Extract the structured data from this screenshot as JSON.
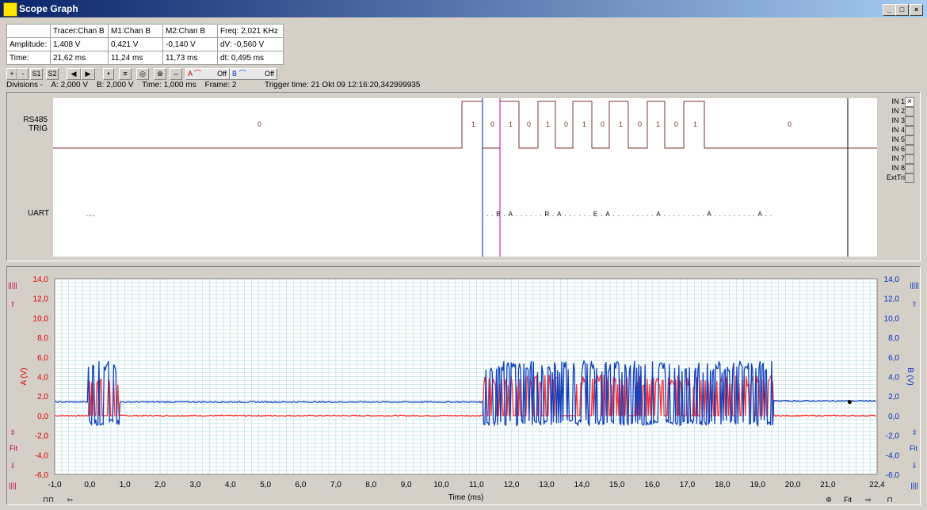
{
  "window": {
    "title": "Scope Graph",
    "controls": [
      "_",
      "□",
      "×"
    ]
  },
  "measurements": {
    "header": [
      "",
      "Tracer:Chan B",
      "M1:Chan B",
      "M2:Chan B",
      "Freq: 2,021 KHz"
    ],
    "rows": [
      [
        "Amplitude:",
        "1,408 V",
        "0,421 V",
        "-0,140 V",
        "dV: -0,560 V"
      ],
      [
        "Time:",
        "21,62 ms",
        "11,24 ms",
        "11,73 ms",
        "dt: 0,495 ms"
      ]
    ]
  },
  "toolbar": {
    "buttons": [
      "+",
      "-",
      "S1",
      "S2",
      "◀",
      "▶",
      "•",
      "≡",
      "◎",
      "⊕",
      "⇔"
    ],
    "channel_a_label": "A",
    "channel_a_state": "Off",
    "channel_b_label": "B",
    "channel_b_state": "Off"
  },
  "divisions": {
    "label": "Divisions -",
    "a": "A: 2,000 V",
    "b": "B: 2,000 V",
    "time": "Time: 1,000 ms",
    "frame": "Frame: 2",
    "trigger_time": "Trigger time: 21 Okt 09 12:16:20,342999935"
  },
  "logic": {
    "channels": [
      {
        "name_line1": "RS485",
        "name_line2": "TRIG"
      },
      {
        "name_line1": "UART",
        "name_line2": ""
      }
    ],
    "bits_left": "0",
    "bits_mid": [
      "1",
      "0",
      "1",
      "0",
      "1",
      "0",
      "1",
      "0",
      "1",
      "0",
      "1",
      "0",
      "1"
    ],
    "bits_right": "0",
    "uart_left": ".....",
    "uart_right": "...B.A......R.A......E.A.........A.........A.........A..",
    "inputs": [
      "IN 1",
      "IN 2",
      "IN 3",
      "IN 4",
      "IN 5",
      "IN 6",
      "IN 7",
      "IN 8",
      "ExtTri"
    ],
    "input_checked": [
      true,
      false,
      false,
      false,
      false,
      false,
      false,
      false,
      false
    ]
  },
  "chart_data": {
    "type": "line",
    "xlabel": "Time (ms)",
    "ylabel_left": "A (V)",
    "ylabel_right": "B (V)",
    "xlim": [
      -1.0,
      22.4
    ],
    "ylim": [
      -6.0,
      14.0
    ],
    "xticks": [
      "-1,0",
      "0,0",
      "1,0",
      "2,0",
      "3,0",
      "4,0",
      "5,0",
      "6,0",
      "7,0",
      "8,0",
      "9,0",
      "10,0",
      "11,0",
      "12,0",
      "13,0",
      "14,0",
      "15,0",
      "16,0",
      "17,0",
      "18,0",
      "19,0",
      "20,0",
      "21,0",
      "22,4"
    ],
    "xtick_values": [
      -1,
      0,
      1,
      2,
      3,
      4,
      5,
      6,
      7,
      8,
      9,
      10,
      11,
      12,
      13,
      14,
      15,
      16,
      17,
      18,
      19,
      20,
      21,
      22.4
    ],
    "yticks": [
      "14,0",
      "12,0",
      "10,0",
      "8,0",
      "6,0",
      "4,0",
      "2,0",
      "0,0",
      "-2,0",
      "-4,0",
      "-6,0"
    ],
    "ytick_values": [
      14,
      12,
      10,
      8,
      6,
      4,
      2,
      0,
      -2,
      -4,
      -6
    ],
    "grid": true,
    "series": [
      {
        "name": "A",
        "color": "#ff3030",
        "baseline": 0.0,
        "high": 3.6,
        "bursts": [
          [
            -0.05,
            0.85
          ],
          [
            11.2,
            19.45
          ]
        ]
      },
      {
        "name": "B",
        "color": "#1040c0",
        "baseline": 1.4,
        "high": 5.0,
        "low": -1.0,
        "bursts": [
          [
            -0.05,
            0.85
          ],
          [
            11.2,
            19.45
          ]
        ],
        "baseline_after": 1.5
      }
    ],
    "colors": {
      "a_axis": "#e00000",
      "b_axis": "#0030c0",
      "grid": "#a8d8d8",
      "plot_bg": "#ffffff"
    }
  },
  "logic_markers": {
    "cursor_m1_ms": 11.24,
    "cursor_m2_ms": 11.73,
    "tracer_ms": 21.62
  },
  "side_icons": {
    "left": [
      "|||||",
      "⇧",
      "⇳",
      "Fit",
      "⇩",
      "||||"
    ],
    "right": [
      "|||||",
      "⇧",
      "⇳",
      "Fit",
      "⇩",
      "||||"
    ],
    "bottom_left": [
      "⊓⊓",
      "⇦"
    ],
    "bottom_right": [
      "Φ",
      "Fit",
      "⇨",
      "⊓"
    ]
  }
}
